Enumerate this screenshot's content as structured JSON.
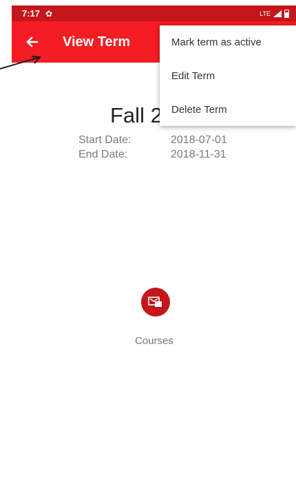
{
  "status_bar": {
    "time": "7:17",
    "network": "LTE",
    "settings_icon": "gear-icon",
    "signal_icon": "signal-icon",
    "battery_icon": "battery-icon"
  },
  "app_bar": {
    "title": "View Term",
    "back_icon": "arrow-back-icon",
    "color": "#f51c24"
  },
  "term": {
    "title": "Fall 2",
    "start_label": "Start Date:",
    "start_value": "2018-07-01",
    "end_label": "End Date:",
    "end_value": "2018-11-31"
  },
  "courses": {
    "label": "Courses",
    "icon": "courses-icon",
    "color": "#c4161b"
  },
  "menu": {
    "items": [
      {
        "label": "Mark term as active"
      },
      {
        "label": "Edit Term"
      },
      {
        "label": "Delete Term"
      }
    ]
  }
}
